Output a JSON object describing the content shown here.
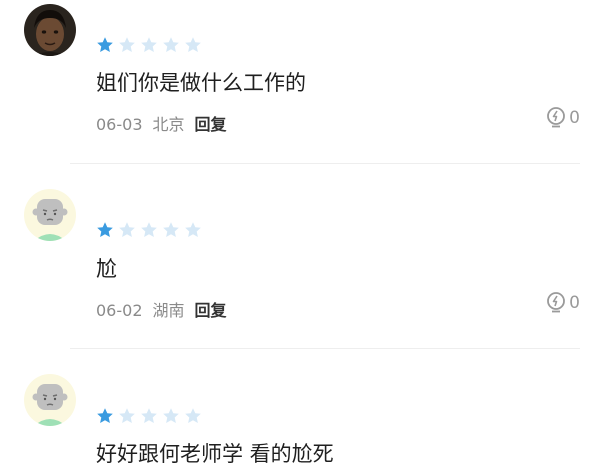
{
  "colors": {
    "star_filled": "#3a9be0",
    "star_empty": "#d6e8f6",
    "meta_text": "#8a8a8a",
    "reply_text": "#333333"
  },
  "comments": [
    {
      "avatar_icon": "user-photo-avatar",
      "rating": 1,
      "max_rating": 5,
      "text": "姐们你是做什么工作的",
      "date": "06-03",
      "location": "北京",
      "reply_label": "回复",
      "like_icon": "lightbulb-icon",
      "like_count": "0"
    },
    {
      "avatar_icon": "default-cartoon-avatar",
      "rating": 1,
      "max_rating": 5,
      "text": "尬",
      "date": "06-02",
      "location": "湖南",
      "reply_label": "回复",
      "like_icon": "lightbulb-icon",
      "like_count": "0"
    },
    {
      "avatar_icon": "default-cartoon-avatar",
      "rating": 1,
      "max_rating": 5,
      "text": "好好跟何老师学 看的尬死",
      "date": "",
      "location": "",
      "reply_label": "",
      "like_icon": "",
      "like_count": ""
    }
  ]
}
